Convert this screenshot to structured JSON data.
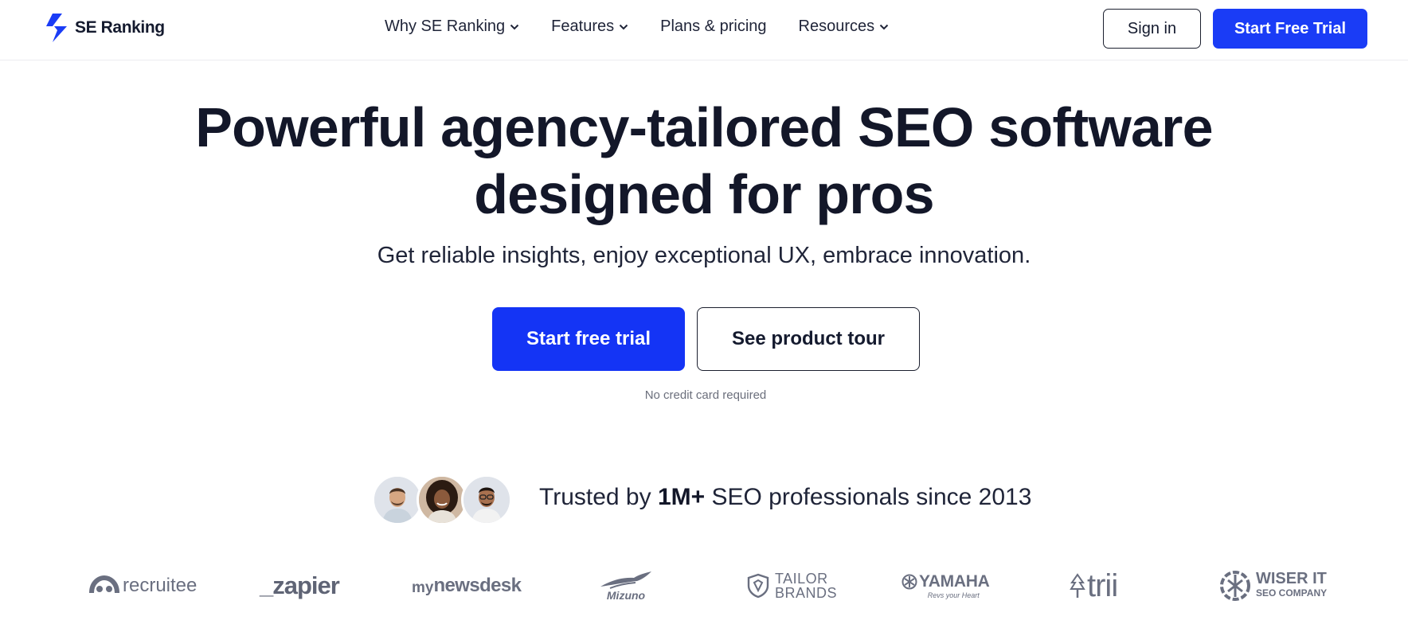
{
  "header": {
    "brand": "SE Ranking",
    "nav": [
      {
        "label": "Why SE Ranking",
        "dropdown": true
      },
      {
        "label": "Features",
        "dropdown": true
      },
      {
        "label": "Plans & pricing",
        "dropdown": false
      },
      {
        "label": "Resources",
        "dropdown": true
      }
    ],
    "sign_in": "Sign in",
    "start_trial": "Start Free Trial"
  },
  "hero": {
    "title_line1": "Powerful agency-tailored SEO software",
    "title_line2": "designed for pros",
    "subtitle": "Get reliable insights, enjoy exceptional UX, embrace innovation.",
    "primary_cta": "Start free trial",
    "secondary_cta": "See product tour",
    "note": "No credit card required"
  },
  "trust": {
    "prefix": "Trusted by ",
    "highlight": "1M+",
    "suffix": " SEO professionals since 2013"
  },
  "logos": {
    "recruitee": "recruitee",
    "zapier": "_zapier",
    "mynewsdesk_my": "my",
    "mynewsdesk_rest": "newsdesk",
    "mizuno": "Mizuno",
    "tailor_1": "TAILOR",
    "tailor_2": "BRANDS",
    "yamaha": "YAMAHA",
    "yamaha_tag": "Revs your Heart",
    "trii": "trii",
    "wiser_1": "WISER IT",
    "wiser_2": "SEO COMPANY"
  },
  "colors": {
    "accent": "#1a3cf6",
    "text": "#131729",
    "muted": "#6a6f80"
  }
}
